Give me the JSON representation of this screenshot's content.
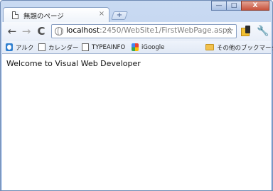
{
  "tab": {
    "title": "無題のページ",
    "close": "×"
  },
  "newtab": {
    "label": "+"
  },
  "window_buttons": {
    "minimize": "—",
    "maximize": "□",
    "close": "X"
  },
  "nav": {
    "back": "←",
    "forward": "→",
    "reload": "C"
  },
  "address": {
    "host": "localhost",
    "path": ":2450/WebSite1/FirstWebPage.aspx",
    "star": "☆"
  },
  "toolbar": {
    "wrench": "🔧"
  },
  "bookmarks": [
    {
      "label": "アルク",
      "icon": "alc-icon"
    },
    {
      "label": "カレンダー",
      "icon": "page-icon"
    },
    {
      "label": "TYPEAINFO",
      "icon": "page-icon"
    },
    {
      "label": "iGoogle",
      "icon": "google-icon"
    }
  ],
  "other_bookmarks": {
    "label": "その他のブックマーク",
    "icon": "folder-icon"
  },
  "page": {
    "text": "Welcome to Visual Web Developer"
  }
}
